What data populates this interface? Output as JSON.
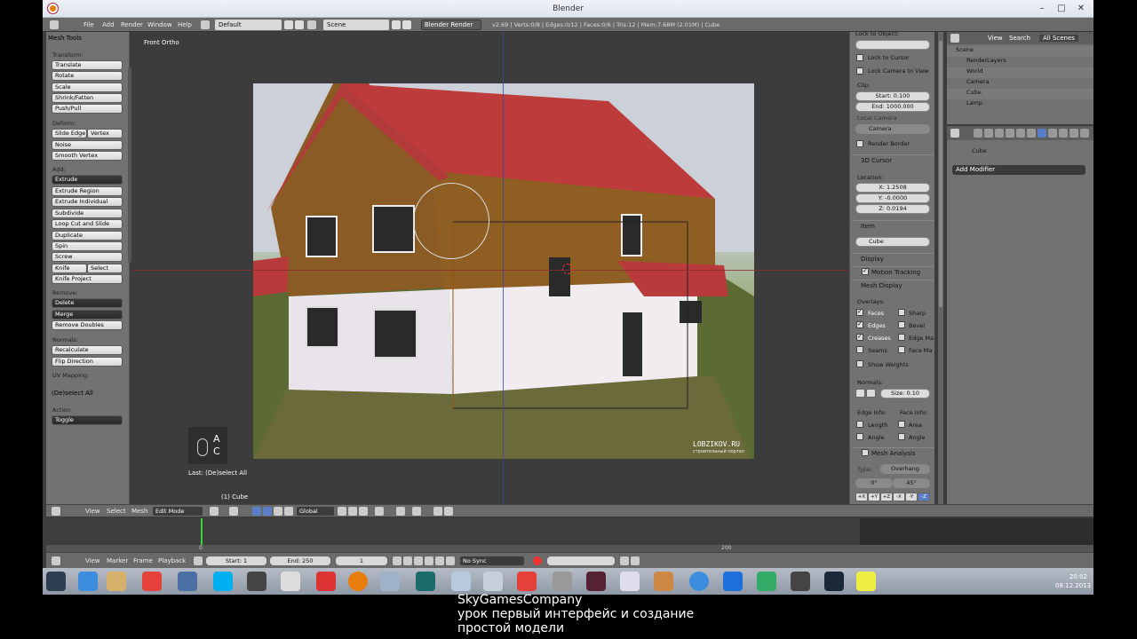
{
  "window": {
    "title": "Blender",
    "minimize": "–",
    "maximize": "□",
    "close": "✕"
  },
  "infobar": {
    "menus": [
      "File",
      "Add",
      "Render",
      "Window",
      "Help"
    ],
    "layout": "Default",
    "scene": "Scene",
    "engine": "Blender Render",
    "stats": "v2.69 | Verts:0/8 | Edges:0/12 | Faces:0/6 | Tris:12 | Mem:7.68M (2.01M) | Cube"
  },
  "toolshelf": {
    "title": "Mesh Tools",
    "transform_label": "Transform:",
    "transform": [
      "Translate",
      "Rotate",
      "Scale",
      "Shrink/Fatten",
      "Push/Pull"
    ],
    "deform_label": "Deform:",
    "slide_edge": "Slide Edge",
    "vertex": "Vertex",
    "noise": "Noise",
    "smooth_vertex": "Smooth Vertex",
    "add_label": "Add:",
    "extrude": "Extrude",
    "extrude_region": "Extrude Region",
    "extrude_individual": "Extrude Individual",
    "subdivide": "Subdivide",
    "loop_cut": "Loop Cut and Slide",
    "duplicate": "Duplicate",
    "spin": "Spin",
    "screw": "Screw",
    "knife": "Knife",
    "select": "Select",
    "knife_project": "Knife Project",
    "remove_label": "Remove:",
    "delete": "Delete",
    "merge": "Merge",
    "remove_doubles": "Remove Doubles",
    "normals_label": "Normals:",
    "recalculate": "Recalculate",
    "flip_direction": "Flip Direction",
    "uv_label": "UV Mapping:",
    "operator_title": "(De)select All",
    "action_label": "Action",
    "action_value": "Toggle"
  },
  "viewport": {
    "view_label": "Front Ortho",
    "key_a": "A",
    "key_c": "C",
    "last_op": "Last: (De)select All",
    "object_name": "(1) Cube",
    "watermark": "LOBZIKOV.RU",
    "watermark_sub": "строительный портал"
  },
  "npanel": {
    "lock_to_object": "Lock to Object:",
    "lock_to_cursor": "Lock to Cursor",
    "lock_camera": "Lock Camera to View",
    "clip": "Clip:",
    "clip_start": "Start: 0.100",
    "clip_end": "End: 1000.000",
    "local_camera": "Local Camera",
    "camera": "Camera",
    "render_border": "Render Border",
    "cursor_title": "3D Cursor",
    "location": "Location:",
    "cursor_x": "X: 1.2508",
    "cursor_y": "Y: -0.0000",
    "cursor_z": "Z: 0.0194",
    "item": "Item",
    "item_name": "Cube",
    "display": "Display",
    "motion_tracking": "Motion Tracking",
    "mesh_display": "Mesh Display",
    "overlays": "Overlays:",
    "faces": "Faces",
    "edges": "Edges",
    "creases": "Creases",
    "seams": "Seams",
    "sharp": "Sharp",
    "bevel": "Bevel",
    "edge_marks": "Edge Ma",
    "face_marks": "Face Ma",
    "show_weights": "Show Weights",
    "normals": "Normals:",
    "size": "Size: 0.10",
    "edge_info": "Edge Info:",
    "face_info": "Face Info:",
    "length": "Length",
    "area": "Area",
    "angle": "Angle",
    "angle2": "Angle",
    "mesh_analysis": "Mesh Analysis",
    "type_label": "Type:",
    "type_value": "Overhang",
    "range_min": "0°",
    "range_max": "45°",
    "axes": [
      "+X",
      "+Y",
      "+Z",
      "-X",
      "-Y",
      "-Z"
    ]
  },
  "outliner": {
    "view": "View",
    "search": "Search",
    "all_scenes": "All Scenes",
    "rows": [
      "Scene",
      "RenderLayers",
      "World",
      "Camera",
      "Cube",
      "Lamp"
    ]
  },
  "properties": {
    "object": "Cube",
    "add_modifier": "Add Modifier"
  },
  "header3d": {
    "view": "View",
    "select": "Select",
    "mesh": "Mesh",
    "mode": "Edit Mode",
    "orientation": "Global"
  },
  "timeline_ruler": {
    "t0": "0",
    "t200": "200"
  },
  "timeline_header": {
    "view": "View",
    "marker": "Marker",
    "frame": "Frame",
    "playback": "Playback",
    "start": "Start: 1",
    "end": "End: 250",
    "current": "1",
    "sync": "No Sync"
  },
  "clock": {
    "time": "20:02",
    "date": "08.12.2013"
  },
  "caption": {
    "line1": "SkyGamesCompany",
    "line2": "урок первый интерфейс и создание",
    "line3": "простой модели"
  }
}
